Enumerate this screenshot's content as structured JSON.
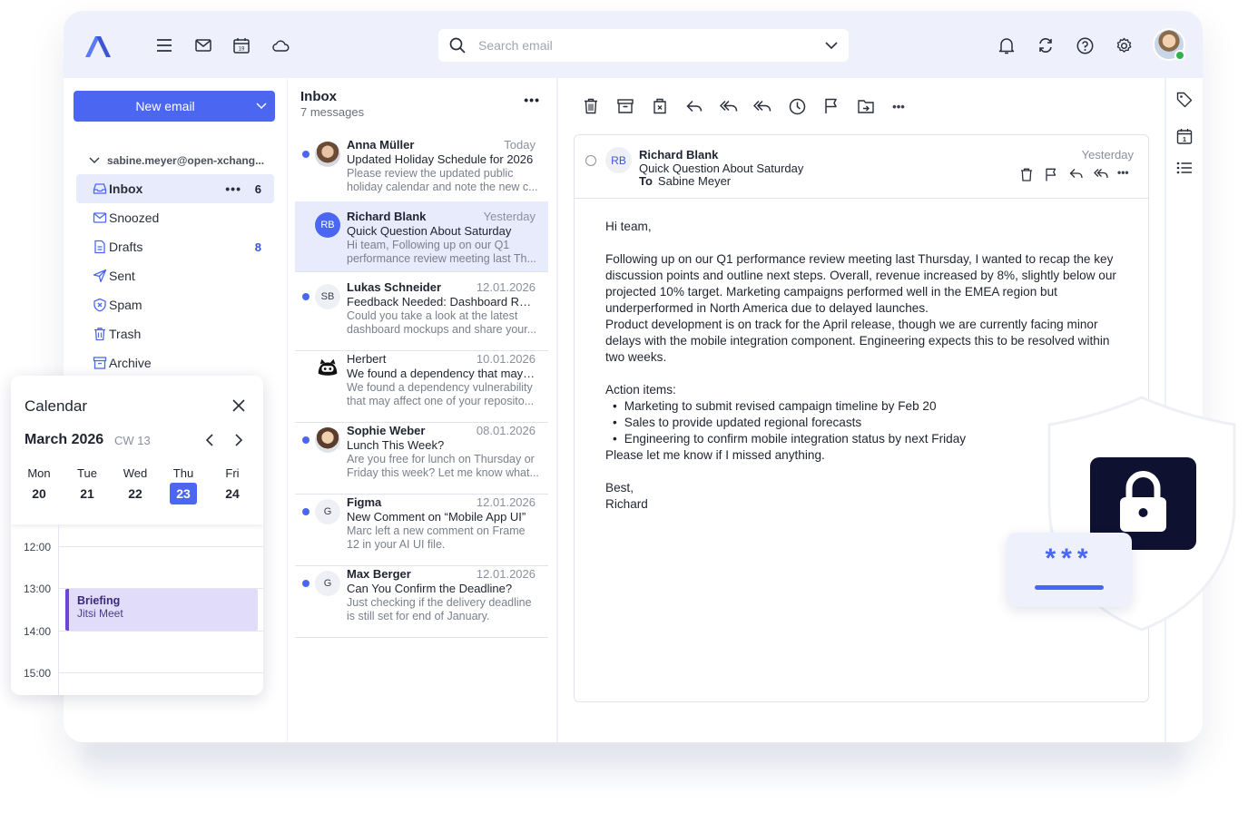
{
  "topbar": {
    "logo": "logo-icon",
    "icons": [
      "menu-icon",
      "mail-icon",
      "calendar-icon",
      "cloud-icon",
      "bell-icon",
      "sync-icon",
      "help-icon",
      "gear-icon"
    ],
    "calendar_icon_day": "19",
    "search_placeholder": "Search email"
  },
  "sidebar": {
    "new_email_label": "New email",
    "account": "sabine.meyer@open-xchang...",
    "folders": [
      {
        "label": "Inbox",
        "count": "6",
        "icon": "inbox-icon",
        "active": true,
        "more": "•••"
      },
      {
        "label": "Snoozed",
        "count": "",
        "icon": "snooze-icon"
      },
      {
        "label": "Drafts",
        "count": "8",
        "icon": "draft-icon"
      },
      {
        "label": "Sent",
        "count": "",
        "icon": "send-icon"
      },
      {
        "label": "Spam",
        "count": "",
        "icon": "spam-icon"
      },
      {
        "label": "Trash",
        "count": "",
        "icon": "trash-icon"
      },
      {
        "label": "Archive",
        "count": "",
        "icon": "archive-icon"
      }
    ]
  },
  "list": {
    "title": "Inbox",
    "subtitle": "7 messages",
    "more": "•••",
    "messages": [
      {
        "from": "Anna Müller",
        "date": "Today",
        "subject": "Updated Holiday Schedule for 2026",
        "preview": "Please review the updated public holiday calendar and note the new c...",
        "avatar": "",
        "unread": true
      },
      {
        "from": "Richard Blank",
        "date": "Yesterday",
        "subject": "Quick Question About Saturday",
        "preview": "Hi team, Following up on our Q1 performance review meeting last Th...",
        "avatar": "RB",
        "unread": false,
        "selected": true
      },
      {
        "from": "Lukas Schneider",
        "date": "12.01.2026",
        "subject": "Feedback Needed: Dashboard Rede...",
        "preview": "Could you take a look at the latest dashboard mockups and share your...",
        "avatar": "SB",
        "unread": true
      },
      {
        "from": "Herbert",
        "date": "10.01.2026",
        "subject": "We found a dependency that may af...",
        "preview": "We found a dependency vulnerability that may affect one of your reposito...",
        "avatar": "",
        "unread": false
      },
      {
        "from": "Sophie Weber",
        "date": "08.01.2026",
        "subject": "Lunch This Week?",
        "preview": "Are you free for lunch on Thursday or Friday this week? Let me know what...",
        "avatar": "",
        "unread": true
      },
      {
        "from": "Figma",
        "date": "12.01.2026",
        "subject": "New Comment on “Mobile App UI”",
        "preview": "Marc left a new comment on Frame 12 in your AI UI file.",
        "avatar": "G",
        "unread": true
      },
      {
        "from": "Max Berger",
        "date": "12.01.2026",
        "subject": "Can You Confirm the Deadline?",
        "preview": "Just checking if the delivery deadline is still set for end of January.",
        "avatar": "G",
        "unread": true
      }
    ]
  },
  "reader": {
    "toolbar_icons": [
      "delete-icon",
      "archive-icon",
      "move-trash-icon",
      "reply-icon",
      "reply-all-icon",
      "forward-icon",
      "snooze-icon",
      "flag-icon",
      "move-icon",
      "more-icon"
    ],
    "more": "•••",
    "avatar": "RB",
    "sender": "Richard Blank",
    "subject": "Quick Question About Saturday",
    "to_label": "To",
    "to_name": "Sabine Meyer",
    "date": "Yesterday",
    "greeting": "Hi team,",
    "paragraph1": "Following up on our Q1 performance review meeting last Thursday, I wanted to recap the key discussion points and outline next steps. Overall, revenue increased by 8%, slightly below our projected 10% target. Marketing campaigns performed well in the EMEA region but underperformed in North America due to delayed launches.",
    "paragraph2": "Product development is on track for the April release, though we are currently facing minor delays with the mobile integration component. Engineering expects this to be resolved within two weeks.",
    "action_title": "Action items:",
    "actions": [
      "Marketing to submit revised campaign timeline by Feb 20",
      "Sales to provide updated regional forecasts",
      "Engineering to confirm mobile integration status by next Friday"
    ],
    "closing_line": "Please let me know if I missed anything.",
    "signoff": "Best,",
    "signature": "Richard"
  },
  "rail": {
    "icons": [
      "tag-icon",
      "calendar-day-icon",
      "list-icon"
    ],
    "calendar_day": "1"
  },
  "calendar": {
    "title": "Calendar",
    "month": "March 2026",
    "week": "CW 13",
    "days": [
      {
        "name": "Mon",
        "num": "20"
      },
      {
        "name": "Tue",
        "num": "21"
      },
      {
        "name": "Wed",
        "num": "22"
      },
      {
        "name": "Thu",
        "num": "23",
        "today": true
      },
      {
        "name": "Fri",
        "num": "24"
      }
    ],
    "hours": [
      "12:00",
      "13:00",
      "14:00",
      "15:00"
    ],
    "event": {
      "title": "Briefing",
      "subtitle": "Jitsi Meet"
    }
  },
  "illustration": {
    "password_mask": "***",
    "icons": [
      "shield-icon",
      "lock-icon"
    ]
  },
  "colors": {
    "accent": "#4b67f1",
    "background": "#eef1fc",
    "event": "#e2dcfb",
    "lock_box": "#0e1130",
    "online": "#34b24a"
  }
}
